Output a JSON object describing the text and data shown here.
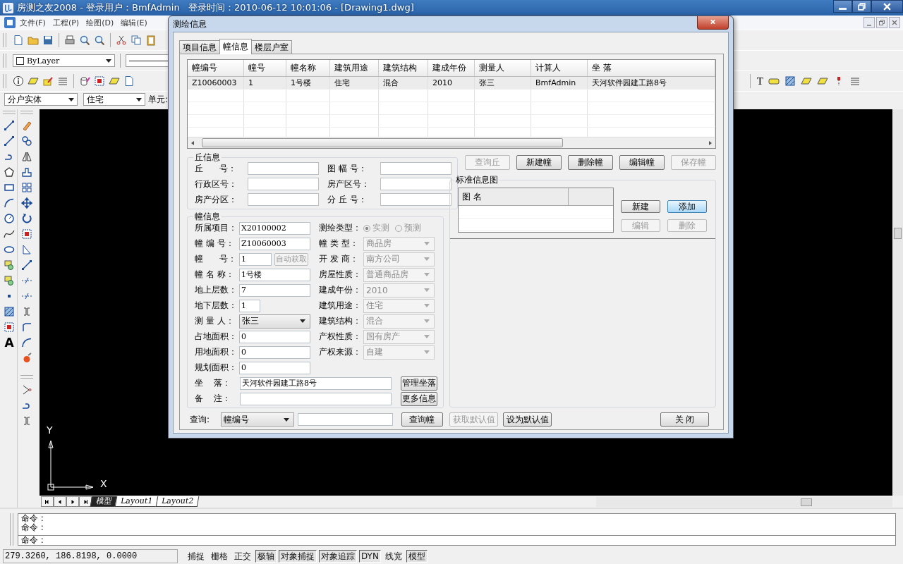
{
  "app": {
    "title": "房测之友2008 - 登录用户：BmfAdmin   登录时间：2010-06-12 10:01:06 - [Drawing1.dwg]"
  },
  "menu": [
    "文件(F)",
    "工程(P)",
    "绘图(D)",
    "编辑(E)"
  ],
  "layer_dropdown": "ByLayer",
  "entity_dropdown": "分户实体",
  "use_dropdown": "住宅",
  "unit_label": "单元:",
  "toolbar_glyphs": {
    "annotate": "T",
    "draw": "A"
  },
  "canvas": {
    "x_axis": "X",
    "y_axis": "Y"
  },
  "layout_tabs": [
    {
      "label": "模型",
      "selected": true
    },
    {
      "label": "Layout1",
      "selected": false
    },
    {
      "label": "Layout2",
      "selected": false
    }
  ],
  "command_lines": [
    "命令 :",
    "命令 :"
  ],
  "command_prompt": "命令 :",
  "status": {
    "coords": "279.3260, 186.8198, 0.0000",
    "toggles": [
      {
        "label": "捕捉",
        "on": false
      },
      {
        "label": "栅格",
        "on": false
      },
      {
        "label": "正交",
        "on": false
      },
      {
        "label": "极轴",
        "on": true
      },
      {
        "label": "对象捕捉",
        "on": true
      },
      {
        "label": "对象追踪",
        "on": true
      },
      {
        "label": "DYN",
        "on": true
      },
      {
        "label": "线宽",
        "on": false
      },
      {
        "label": "模型",
        "on": true
      }
    ]
  },
  "dialog": {
    "title": "测绘信息",
    "tabs": [
      {
        "label": "项目信息",
        "selected": false
      },
      {
        "label": "幢信息",
        "selected": true
      },
      {
        "label": "楼层户室",
        "selected": false
      }
    ],
    "table": {
      "columns": [
        "幢编号",
        "幢号",
        "幢名称",
        "建筑用途",
        "建筑结构",
        "建成年份",
        "测量人",
        "计算人",
        "坐 落"
      ],
      "rows": [
        [
          "Z10060003",
          "1",
          "1号楼",
          "住宅",
          "混合",
          "2010",
          "张三",
          "BmfAdmin",
          "天河软件园建工路8号"
        ]
      ]
    },
    "parcel_group": {
      "title": "丘信息",
      "fields": [
        {
          "label": "丘      号："
        },
        {
          "label": "图 幅 号："
        },
        {
          "label": "行政区号："
        },
        {
          "label": "房产区号："
        },
        {
          "label": "房产分区："
        },
        {
          "label": "分 丘 号："
        }
      ]
    },
    "building_group": {
      "title": "幢信息",
      "left_fields": [
        {
          "label": "所属项目：",
          "kind": "text",
          "value": "X20100002"
        },
        {
          "label": "幢 编 号：",
          "kind": "text",
          "value": "Z10060003"
        },
        {
          "label": "幢      号：",
          "kind": "short",
          "value": "1",
          "button": {
            "label": "自动获取",
            "disabled": true
          }
        },
        {
          "label": "幢 名 称：",
          "kind": "text",
          "value": "1号楼"
        },
        {
          "label": "地上层数：",
          "kind": "text",
          "value": "7"
        },
        {
          "label": "地下层数：",
          "kind": "tiny",
          "value": "1"
        },
        {
          "label": "测 量 人：",
          "kind": "select",
          "value": "张三",
          "disabled": false
        },
        {
          "label": "占地面积：",
          "kind": "text",
          "value": "0"
        },
        {
          "label": "用地面积：",
          "kind": "text",
          "value": "0"
        },
        {
          "label": "规划面积：",
          "kind": "text",
          "value": "0"
        }
      ],
      "right_fields": [
        {
          "label": "测绘类型：",
          "kind": "radio",
          "disabled": true,
          "options": [
            {
              "label": "实测",
              "selected": true
            },
            {
              "label": "预测",
              "selected": false
            }
          ]
        },
        {
          "label": "幢 类 型：",
          "kind": "select",
          "value": "商品房",
          "disabled": true
        },
        {
          "label": "开 发 商：",
          "kind": "select",
          "value": "南方公司",
          "disabled": true
        },
        {
          "label": "房屋性质：",
          "kind": "select",
          "value": "普通商品房",
          "disabled": true
        },
        {
          "label": "建成年份：",
          "kind": "select",
          "value": "2010",
          "disabled": true
        },
        {
          "label": "建筑用途：",
          "kind": "select",
          "value": "住宅",
          "disabled": true
        },
        {
          "label": "建筑结构：",
          "kind": "select",
          "value": "混合",
          "disabled": true
        },
        {
          "label": "产权性质：",
          "kind": "select",
          "value": "国有房产",
          "disabled": true
        },
        {
          "label": "产权来源：",
          "kind": "select",
          "value": "自建",
          "disabled": true
        }
      ],
      "address": {
        "label": "坐    落：",
        "value": "天河软件园建工路8号",
        "button": "管理坐落"
      },
      "remark": {
        "label": "备    注：",
        "button": "更多信息"
      }
    },
    "query": {
      "label": "查询:",
      "select": "幢编号",
      "button": "查询幢"
    },
    "actions": [
      {
        "label": "查询丘",
        "disabled": true
      },
      {
        "label": "新建幢",
        "disabled": false
      },
      {
        "label": "删除幢",
        "disabled": false
      },
      {
        "label": "编辑幢",
        "disabled": false
      },
      {
        "label": "保存幢",
        "disabled": true
      }
    ],
    "info_group": {
      "title": "标准信息图",
      "columns": [
        "图 名"
      ],
      "buttons": [
        {
          "label": "新建",
          "disabled": false,
          "hovered": false
        },
        {
          "label": "添加",
          "disabled": false,
          "hovered": true
        },
        {
          "label": "编辑",
          "disabled": true,
          "hovered": false
        },
        {
          "label": "删除",
          "disabled": true,
          "hovered": false
        }
      ]
    },
    "footer_buttons": [
      {
        "label": "获取默认值",
        "disabled": true
      },
      {
        "label": "设为默认值",
        "disabled": false
      },
      {
        "label": "关 闭",
        "disabled": false
      }
    ]
  }
}
